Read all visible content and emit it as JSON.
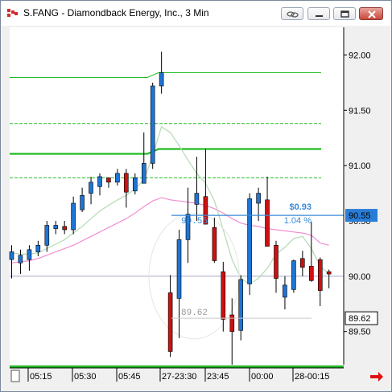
{
  "window": {
    "title": "S.FANG - Diamondback Energy, Inc., 3 Min",
    "buttons": [
      "link",
      "minimize",
      "maximize",
      "close"
    ]
  },
  "colors": {
    "up": "#1f74d4",
    "down": "#cc1111",
    "level_green": "#22bb22",
    "ma_fast": "#b9dcb9",
    "ma_slow": "#f08ecf",
    "ref_line": "#3a8ad8",
    "price_tag": "#2a7dd6"
  },
  "chart_data": {
    "type": "candlestick",
    "ylim": [
      89.2,
      92.25
    ],
    "y_ticks": [
      {
        "v": 92.0,
        "label": "92.00"
      },
      {
        "v": 91.5,
        "label": "91.50"
      },
      {
        "v": 91.0,
        "label": "91.00"
      },
      {
        "v": 89.5,
        "label": "89.50"
      }
    ],
    "x_ticks": [
      "05:15",
      "05:30",
      "05:45",
      "27-23:30",
      "23:45",
      "00:00",
      "28-00:15"
    ],
    "candles": [
      {
        "o": 90.15,
        "h": 90.28,
        "l": 89.98,
        "c": 90.22
      },
      {
        "o": 90.12,
        "h": 90.24,
        "l": 90.02,
        "c": 90.19
      },
      {
        "o": 90.15,
        "h": 90.28,
        "l": 90.05,
        "c": 90.24
      },
      {
        "o": 90.22,
        "h": 90.32,
        "l": 90.18,
        "c": 90.28
      },
      {
        "o": 90.28,
        "h": 90.5,
        "l": 90.22,
        "c": 90.46
      },
      {
        "o": 90.43,
        "h": 90.5,
        "l": 90.38,
        "c": 90.46
      },
      {
        "o": 90.45,
        "h": 90.5,
        "l": 90.38,
        "c": 90.42
      },
      {
        "o": 90.42,
        "h": 90.72,
        "l": 90.38,
        "c": 90.66
      },
      {
        "o": 90.6,
        "h": 90.8,
        "l": 90.58,
        "c": 90.73
      },
      {
        "o": 90.75,
        "h": 90.9,
        "l": 90.65,
        "c": 90.85
      },
      {
        "o": 90.81,
        "h": 90.93,
        "l": 90.73,
        "c": 90.9
      },
      {
        "o": 90.89,
        "h": 90.87,
        "l": 90.8,
        "c": 90.85
      },
      {
        "o": 90.85,
        "h": 90.97,
        "l": 90.82,
        "c": 90.93
      },
      {
        "o": 90.93,
        "h": 90.97,
        "l": 90.62,
        "c": 90.76
      },
      {
        "o": 90.77,
        "h": 90.93,
        "l": 90.74,
        "c": 90.89
      },
      {
        "o": 90.84,
        "h": 91.3,
        "l": 90.84,
        "c": 91.02
      },
      {
        "o": 91.02,
        "h": 91.75,
        "l": 90.97,
        "c": 91.72
      },
      {
        "o": 91.72,
        "h": 92.03,
        "l": 91.65,
        "c": 91.84
      },
      {
        "o": 89.85,
        "h": 90.01,
        "l": 89.27,
        "c": 89.32
      },
      {
        "o": 89.8,
        "h": 90.42,
        "l": 89.44,
        "c": 90.33
      },
      {
        "o": 90.33,
        "h": 90.8,
        "l": 90.12,
        "c": 90.56
      },
      {
        "o": 90.65,
        "h": 91.08,
        "l": 90.5,
        "c": 90.75
      },
      {
        "o": 90.72,
        "h": 91.15,
        "l": 90.52,
        "c": 90.47
      },
      {
        "o": 90.44,
        "h": 90.53,
        "l": 90.12,
        "c": 90.14
      },
      {
        "o": 90.04,
        "h": 90.13,
        "l": 89.5,
        "c": 89.61
      },
      {
        "o": 89.65,
        "h": 89.8,
        "l": 89.2,
        "c": 89.5
      },
      {
        "o": 89.51,
        "h": 90.01,
        "l": 89.42,
        "c": 89.97
      },
      {
        "o": 89.93,
        "h": 90.75,
        "l": 89.83,
        "c": 90.7
      },
      {
        "o": 90.66,
        "h": 90.8,
        "l": 90.5,
        "c": 90.75
      },
      {
        "o": 90.69,
        "h": 90.9,
        "l": 90.4,
        "c": 90.27
      },
      {
        "o": 90.28,
        "h": 90.32,
        "l": 89.85,
        "c": 89.98
      },
      {
        "o": 89.81,
        "h": 90.0,
        "l": 89.7,
        "c": 89.92
      },
      {
        "o": 89.88,
        "h": 90.15,
        "l": 89.85,
        "c": 90.14
      },
      {
        "o": 90.16,
        "h": 90.23,
        "l": 90.0,
        "c": 90.08
      },
      {
        "o": 90.09,
        "h": 90.49,
        "l": 89.95,
        "c": 89.96
      },
      {
        "o": 90.15,
        "h": 90.17,
        "l": 89.73,
        "c": 89.87
      },
      {
        "o": 90.04,
        "h": 90.06,
        "l": 89.89,
        "c": 90.02
      }
    ],
    "ma_fast": [
      90.21,
      90.2,
      90.2,
      90.21,
      90.25,
      90.29,
      90.33,
      90.39,
      90.45,
      90.52,
      90.59,
      90.64,
      90.69,
      90.73,
      90.79,
      90.87,
      91.09,
      91.35,
      91.3,
      91.18,
      91.05,
      90.93,
      90.84,
      90.68,
      90.42,
      90.15,
      89.98,
      89.93,
      89.98,
      90.07,
      90.2,
      90.26,
      90.34,
      90.36,
      90.25,
      90.09,
      90.02
    ],
    "ma_slow": [
      90.12,
      90.13,
      90.14,
      90.16,
      90.19,
      90.22,
      90.25,
      90.28,
      90.32,
      90.36,
      90.4,
      90.44,
      90.48,
      90.52,
      90.57,
      90.63,
      90.68,
      90.71,
      90.69,
      90.68,
      90.67,
      90.66,
      90.64,
      90.61,
      90.57,
      90.52,
      90.48,
      90.46,
      90.45,
      90.43,
      90.42,
      90.41,
      90.4,
      90.39,
      90.37,
      90.3,
      90.28
    ],
    "levels": [
      {
        "v": 91.84,
        "style": "solid",
        "start_candle": 0
      },
      {
        "v": 91.38,
        "style": "dashed",
        "start_candle": 0
      },
      {
        "v": 91.15,
        "style": "bold",
        "start_candle": 0
      },
      {
        "v": 90.89,
        "style": "dashed",
        "start_candle": 0
      }
    ],
    "ref_line": {
      "v": 90.0
    },
    "last_price": "90.55",
    "last_price_v": 90.55,
    "low_marker": {
      "label": "89.62",
      "v": 89.62
    },
    "hi_marker": {
      "label": "90.55",
      "v": 90.55
    },
    "change_abs": "$0.93",
    "change_pct": "1.04 %",
    "ellipse_label": "",
    "hidden_tick_label": "90.50",
    "zero_tick_label": "90.00"
  }
}
